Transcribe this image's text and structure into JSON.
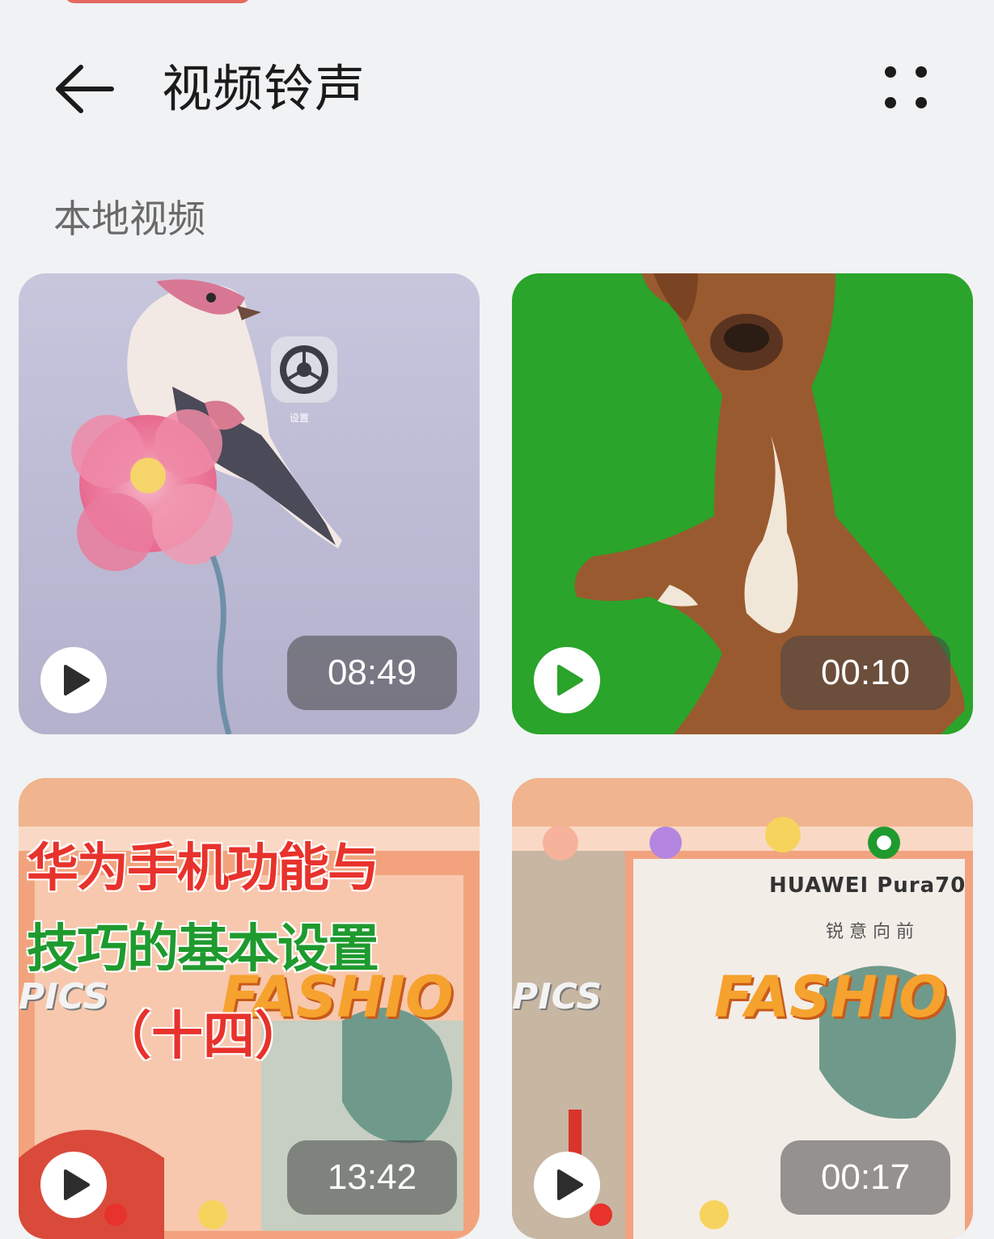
{
  "header": {
    "title": "视频铃声",
    "back_icon": "arrow-left-icon",
    "more_icon": "more-dots-icon"
  },
  "section": {
    "label": "本地视频"
  },
  "videos": [
    {
      "duration": "08:49",
      "thumbnail_caption": "设置"
    },
    {
      "duration": "00:10"
    },
    {
      "duration": "13:42",
      "title_line1": "华为手机功能与",
      "title_line2": "技巧的基本设置",
      "title_line3": "（十四）",
      "sticker_left": "PICS",
      "sticker_right": "FASHIO"
    },
    {
      "duration": "00:17",
      "brand_text": "HUAWEI Pura70",
      "slogan": "锐 意 向 前",
      "sticker_left": "PICS",
      "sticker_right": "FASHIO"
    }
  ],
  "colors": {
    "background": "#f1f2f4",
    "green_screen": "#2aa42a",
    "title_red": "#e8322c",
    "title_green": "#1f9a2e"
  }
}
